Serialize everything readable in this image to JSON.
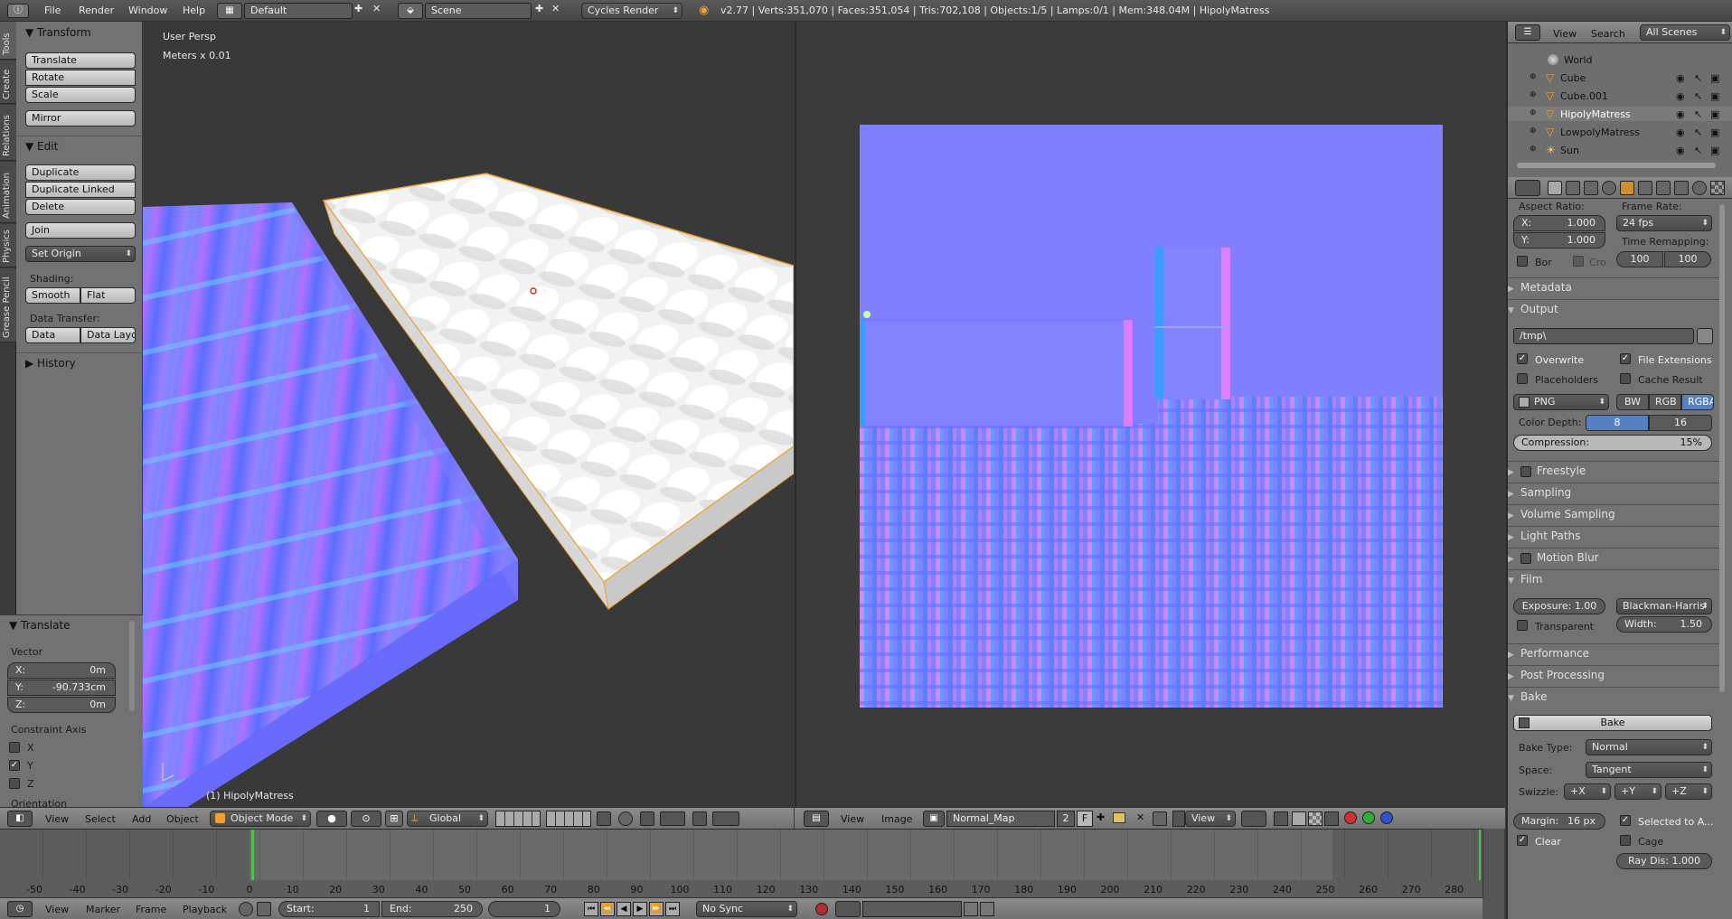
{
  "topbar": {
    "menus": [
      "File",
      "Render",
      "Window",
      "Help"
    ],
    "layout": "Default",
    "scene": "Scene",
    "engine": "Cycles Render",
    "stats": "v2.77 | Verts:351,070 | Faces:351,054 | Tris:702,108 | Objects:1/5 | Lamps:0/1 | Mem:348.04M | HipolyMatress"
  },
  "tools": {
    "tabs": [
      "Tools",
      "Create",
      "Relations",
      "Animation",
      "Physics",
      "Grease Pencil"
    ],
    "transform": {
      "title": "Transform",
      "buttons": [
        "Translate",
        "Rotate",
        "Scale",
        "Mirror"
      ]
    },
    "edit": {
      "title": "Edit",
      "buttons": [
        "Duplicate",
        "Duplicate Linked",
        "Delete",
        "Join"
      ],
      "set_origin": "Set Origin",
      "shading_label": "Shading:",
      "smooth": "Smooth",
      "flat": "Flat",
      "data_transfer_label": "Data Transfer:",
      "data": "Data",
      "data_layout": "Data Layo"
    },
    "history": "History"
  },
  "operator": {
    "title": "Translate",
    "vector_label": "Vector",
    "x": "X:",
    "x_val": "0m",
    "y": "Y:",
    "y_val": "-90.733cm",
    "z": "Z:",
    "z_val": "0m",
    "constraint_label": "Constraint Axis",
    "cx": "X",
    "cy": "Y",
    "cz": "Z",
    "orientation_label": "Orientation"
  },
  "viewport": {
    "view_name": "User Persp",
    "units": "Meters x 0.01",
    "object_label": "(1) HipolyMatress"
  },
  "v3d_header": {
    "menus": [
      "View",
      "Select",
      "Add",
      "Object"
    ],
    "mode": "Object Mode",
    "orientation": "Global"
  },
  "image_header": {
    "menus": [
      "View",
      "Image"
    ],
    "image_name": "Normal_Map",
    "users": "2",
    "fake": "F",
    "view": "View"
  },
  "outliner": {
    "menus": [
      "View",
      "Search"
    ],
    "scope": "All Scenes",
    "items": [
      {
        "name": "World"
      },
      {
        "name": "Cube"
      },
      {
        "name": "Cube.001"
      },
      {
        "name": "HipolyMatress"
      },
      {
        "name": "LowpolyMatress"
      },
      {
        "name": "Sun"
      }
    ]
  },
  "properties": {
    "aspect_label": "Aspect Ratio:",
    "ax_label": "X:",
    "ax": "1.000",
    "ay_label": "Y:",
    "ay": "1.000",
    "bor": "Bor",
    "cro": "Cro",
    "frame_rate_label": "Frame Rate:",
    "frame_rate": "24 fps",
    "time_remap_label": "Time Remapping:",
    "remap_old": "100",
    "remap_new": "100",
    "metadata": "Metadata",
    "output": "Output",
    "path": "/tmp\\",
    "overwrite": "Overwrite",
    "file_ext": "File Extensions",
    "placeholders": "Placeholders",
    "cache_result": "Cache Result",
    "format": "PNG",
    "bw": "BW",
    "rgb": "RGB",
    "rgba": "RGBA",
    "color_depth_label": "Color Depth:",
    "depth_8": "8",
    "depth_16": "16",
    "compression_label": "Compression:",
    "compression": "15%",
    "freestyle": "Freestyle",
    "sampling": "Sampling",
    "volume_sampling": "Volume Sampling",
    "light_paths": "Light Paths",
    "motion_blur": "Motion Blur",
    "film": "Film",
    "exposure": "Exposure: 1.00",
    "filter": "Blackman-Harris",
    "transparent": "Transparent",
    "width": "Width:",
    "width_val": "1.50",
    "performance": "Performance",
    "post_processing": "Post Processing",
    "bake": "Bake",
    "bake_button": "Bake",
    "bake_type_label": "Bake Type:",
    "bake_type": "Normal",
    "space_label": "Space:",
    "space": "Tangent",
    "swizzle_label": "Swizzle:",
    "sw_x": "+X",
    "sw_y": "+Y",
    "sw_z": "+Z",
    "margin": "Margin:",
    "margin_val": "16 px",
    "selected_to_active": "Selected to A...",
    "clear": "Clear",
    "cage": "Cage",
    "ray_dis": "Ray Dis: 1.000"
  },
  "timeline": {
    "ticks": [
      "-50",
      "-40",
      "-30",
      "-20",
      "-10",
      "0",
      "10",
      "20",
      "30",
      "40",
      "50",
      "60",
      "70",
      "80",
      "90",
      "100",
      "110",
      "120",
      "130",
      "140",
      "150",
      "160",
      "170",
      "180",
      "190",
      "200",
      "210",
      "220",
      "230",
      "240",
      "250",
      "260",
      "270",
      "280"
    ],
    "menus": [
      "View",
      "Marker",
      "Frame",
      "Playback"
    ],
    "start_label": "Start:",
    "start": "1",
    "end_label": "End:",
    "end": "250",
    "current": "1",
    "sync": "No Sync"
  },
  "colors": {
    "normal_base": "#8080ff",
    "accent": "#5680c2",
    "selected_orange": "#f0a030"
  }
}
